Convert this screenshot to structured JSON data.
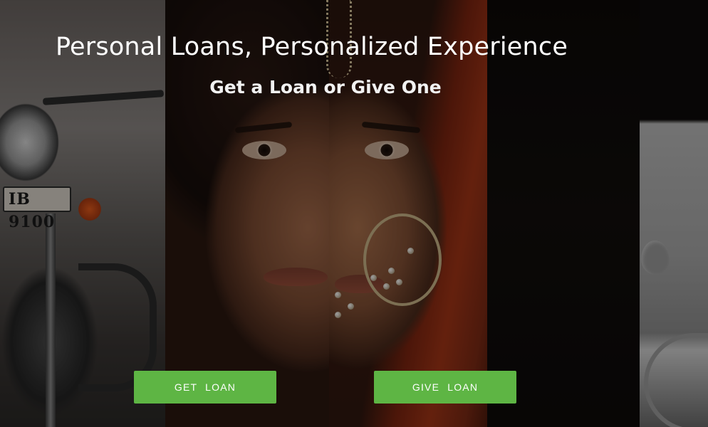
{
  "hero": {
    "headline": "Personal Loans, Personalized Experience",
    "subheadline": "Get a Loan or Give One",
    "background_plate_text": "IB 9100",
    "overlay_color": "#000000"
  },
  "actions": {
    "get_loan_label": "GET LOAN",
    "give_loan_label": "GIVE LOAN",
    "button_color": "#5eb544",
    "button_text_color": "#ffffff"
  }
}
